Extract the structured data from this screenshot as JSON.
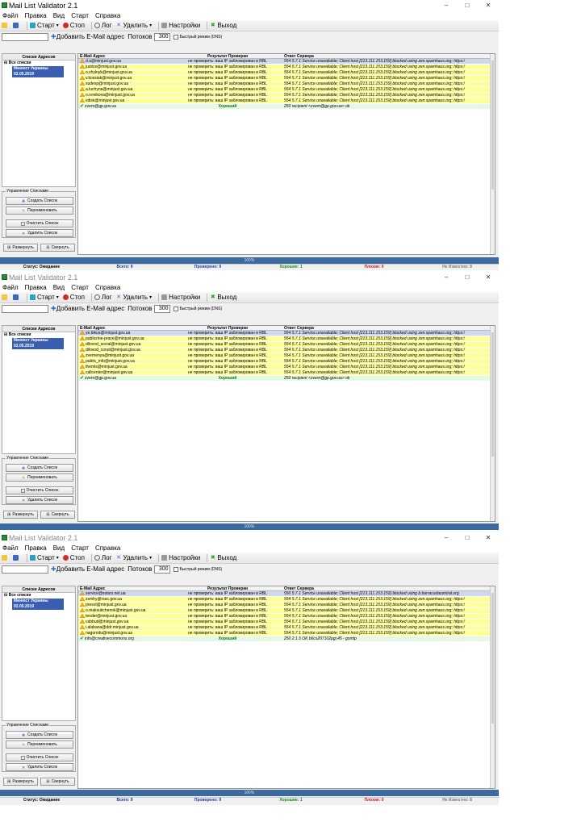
{
  "app": {
    "title": "Mail List Validator 2.1",
    "window_controls": [
      "–",
      "□",
      "✕"
    ]
  },
  "menu": [
    "Файл",
    "Правка",
    "Вид",
    "Старт",
    "Справка"
  ],
  "toolbar": {
    "start": "Старт",
    "stop": "Стоп",
    "log": "Лог",
    "delete": "Удалить",
    "settings": "Настройки",
    "exit": "Выход"
  },
  "addbar": {
    "add_label": "Добавить E-Mail адрес",
    "threads_label": "Потоков",
    "threads_value": "300",
    "fast_mode": "Быстрый режим (DNS)"
  },
  "tree": {
    "header": "Списки Адресов",
    "root": "Все списки",
    "list": "Минюст Украины 02.05.2019"
  },
  "manage": {
    "group_label": "Управление Списками",
    "create": "Создать Список",
    "rename": "Переименовать",
    "clear": "Очистить Список",
    "delete": "Удалить Список",
    "expand": "Развернуть",
    "collapse": "Свернуть"
  },
  "columns": [
    "E-Mail Адрес",
    "Результат Проверки",
    "Ответ Сервера"
  ],
  "progress_text": "100%",
  "status": {
    "state": "Статус: Ожидание",
    "total": "Всего: 9",
    "checked": "Проверено: 9",
    "good": "Хорошие: 1",
    "bad": "Плохие: 0",
    "unknown": "Не Известно: 8"
  },
  "colors": {
    "warn_row": "#ffff99",
    "good_row": "#e4f8e4",
    "selected_row": "#cfd8ef",
    "progress": "#3a6aa0"
  },
  "panels": [
    {
      "rows": [
        {
          "email": "d.a@minjust.gov.ua",
          "result": "не проверить: ваш IP заблокирован в RBL",
          "response": "554 5.7.1 Service unavailable; Client host [213.111.153.159] blocked using zen.spamhaus.org; https:/",
          "type": "sel"
        },
        {
          "email": "justice@minjust.gov.ua",
          "result": "не проверить: ваш IP заблокирован в RBL",
          "response": "554 5.7.1 Service unavailable; Client host [213.111.153.159] blocked using zen.spamhaus.org; https:/",
          "type": "warn"
        },
        {
          "email": "o.zhylnyk@minjust.gov.ua",
          "result": "не проверить: ваш IP заблокирован в RBL",
          "response": "554 5.7.1 Service unavailable; Client host [213.111.153.159] blocked using zen.spamhaus.org; https:/",
          "type": "warn"
        },
        {
          "email": "v.kossiak@minjust.gov.ua",
          "result": "не проверить: ваш IP заблокирован в RBL",
          "response": "554 5.7.1 Service unavailable; Client host [213.111.153.159] blocked using zen.spamhaus.org; https:/",
          "type": "warn"
        },
        {
          "email": "sudexp@minjust.gov.ua",
          "result": "не проверить: ваш IP заблокирован в RBL",
          "response": "554 5.7.1 Service unavailable; Client host [213.111.153.159] blocked using zen.spamhaus.org; https:/",
          "type": "warn"
        },
        {
          "email": "a.luchyna@minjust.gov.ua",
          "result": "не проверить: ваш IP заблокирован в RBL",
          "response": "554 5.7.1 Service unavailable; Client host [213.111.153.159] blocked using zen.spamhaus.org; https:/",
          "type": "warn"
        },
        {
          "email": "o.novikova@minjust.gov.ua",
          "result": "не проверить: ваш IP заблокирован в RBL",
          "response": "554 5.7.1 Service unavailable; Client host [213.111.153.159] blocked using zen.spamhaus.org; https:/",
          "type": "warn"
        },
        {
          "email": "vdisk@minjust.gov.ua",
          "result": "не проверить: ваш IP заблокирован в RBL",
          "response": "554 5.7.1 Service unavailable; Client host [213.111.153.159] blocked using zen.spamhaus.org; https:/",
          "type": "warn"
        },
        {
          "email": "zvern@gp.gov.ua",
          "result": "Хороший",
          "response": "250 recipient <zvern@gp.gov.ua> ok",
          "type": "good"
        }
      ]
    },
    {
      "rows": [
        {
          "email": "ye.bikus@minjust.gov.ua",
          "result": "не проверить: ваш IP заблокирован в RBL",
          "response": "554 5.7.1 Service unavailable; Client host [213.111.153.159] blocked using zen.spamhaus.org; https:/",
          "type": "sel"
        },
        {
          "email": "publicrine-pravo@minjust.gov.ua",
          "result": "не проверить: ваш IP заблокирован в RBL",
          "response": "554 5.7.1 Service unavailable; Client host [213.111.153.159] blocked using zen.spamhaus.org; https:/",
          "type": "warn"
        },
        {
          "email": "dilovod_social@minjust.gov.ua",
          "result": "не проверить: ваш IP заблокирован в RBL",
          "response": "554 5.7.1 Service unavailable; Client host [213.111.153.159] blocked using zen.spamhaus.org; https:/",
          "type": "warn"
        },
        {
          "email": "dilovod_coruti@minjust.gov.ua",
          "result": "не проверить: ваш IP заблокирован в RBL",
          "response": "554 5.7.1 Service unavailable; Client host [213.111.153.159] blocked using zen.spamhaus.org; https:/",
          "type": "warn"
        },
        {
          "email": "zvernenya@minjust.gov.ua",
          "result": "не проверить: ваш IP заблокирован в RBL",
          "response": "554 5.7.1 Service unavailable; Client host [213.111.153.159] blocked using zen.spamhaus.org; https:/",
          "type": "warn"
        },
        {
          "email": "public_info@minjust.gov.ua",
          "result": "не проверить: ваш IP заблокирован в RBL",
          "response": "554 5.7.1 Service unavailable; Client host [213.111.153.159] blocked using zen.spamhaus.org; https:/",
          "type": "warn"
        },
        {
          "email": "themis@minjust.gov.ua",
          "result": "не проверить: ваш IP заблокирован в RBL",
          "response": "554 5.7.1 Service unavailable; Client host [213.111.153.159] blocked using zen.spamhaus.org; https:/",
          "type": "warn"
        },
        {
          "email": "callcenter@minjust.gov.ua",
          "result": "не проверить: ваш IP заблокирован в RBL",
          "response": "554 5.7.1 Service unavailable; Client host [213.111.153.159] blocked using zen.spamhaus.org; https:/",
          "type": "warn"
        },
        {
          "email": "zvern@gp.gov.ua",
          "result": "Хороший",
          "response": "250 recipient <zvern@gp.gov.ua> ok",
          "type": "good"
        }
      ]
    },
    {
      "rows": [
        {
          "email": "service@sstars.net.ua",
          "result": "не проверить: ваш IP заблокирован в RBL",
          "response": "550 5.7.1 Service unavailable; Client host [213.111.153.159] blocked using b.barracudacentral.org",
          "type": "sel"
        },
        {
          "email": "zsmhy@rsac.gov.ua",
          "result": "не проверить: ваш IP заблокирован в RBL",
          "response": "554 5.7.1 Service unavailable; Client host [213.111.153.159] blocked using zen.spamhaus.org; https:/",
          "type": "warn"
        },
        {
          "email": "presol@minjust.gov.ua",
          "result": "не проверить: ваш IP заблокирован в RBL",
          "response": "554 5.7.1 Service unavailable; Client host [213.111.153.159] blocked using zen.spamhaus.org; https:/",
          "type": "warn"
        },
        {
          "email": "o.maksutichenok@minjust.gov.ua",
          "result": "не проверить: ваш IP заблокирован в RBL",
          "response": "554 5.7.1 Service unavailable; Client host [213.111.153.159] blocked using zen.spamhaus.org; https:/",
          "type": "warn"
        },
        {
          "email": "tender@minjust.gov.ua",
          "result": "не проверить: ваш IP заблокирован в RBL",
          "response": "554 5.7.1 Service unavailable; Client host [213.111.153.159] blocked using zen.spamhaus.org; https:/",
          "type": "warn"
        },
        {
          "email": "cabbud@minjust.gov.ua",
          "result": "не проверить: ваш IP заблокирован в RBL",
          "response": "554 5.7.1 Service unavailable; Client host [213.111.153.159] blocked using zen.spamhaus.org; https:/",
          "type": "warn"
        },
        {
          "email": "i.alabana@ddr.minjust.gov.ua",
          "result": "не проверить: ваш IP заблокирован в RBL",
          "response": "554 5.7.1 Service unavailable; Client host [213.111.153.159] blocked using zen.spamhaus.org; https:/",
          "type": "warn"
        },
        {
          "email": "nagorodu@minjust.gov.ua",
          "result": "не проверить: ваш IP заблокирован в RBL",
          "response": "554 5.7.1 Service unavailable; Client host [213.111.153.159] blocked using zen.spamhaus.org; https:/",
          "type": "warn"
        },
        {
          "email": "info@creativecommons.org",
          "result": "Хороший",
          "response": "250 2.1.5 OK b6cs207102pgi.45 - gsmtp",
          "type": "good"
        }
      ]
    }
  ]
}
